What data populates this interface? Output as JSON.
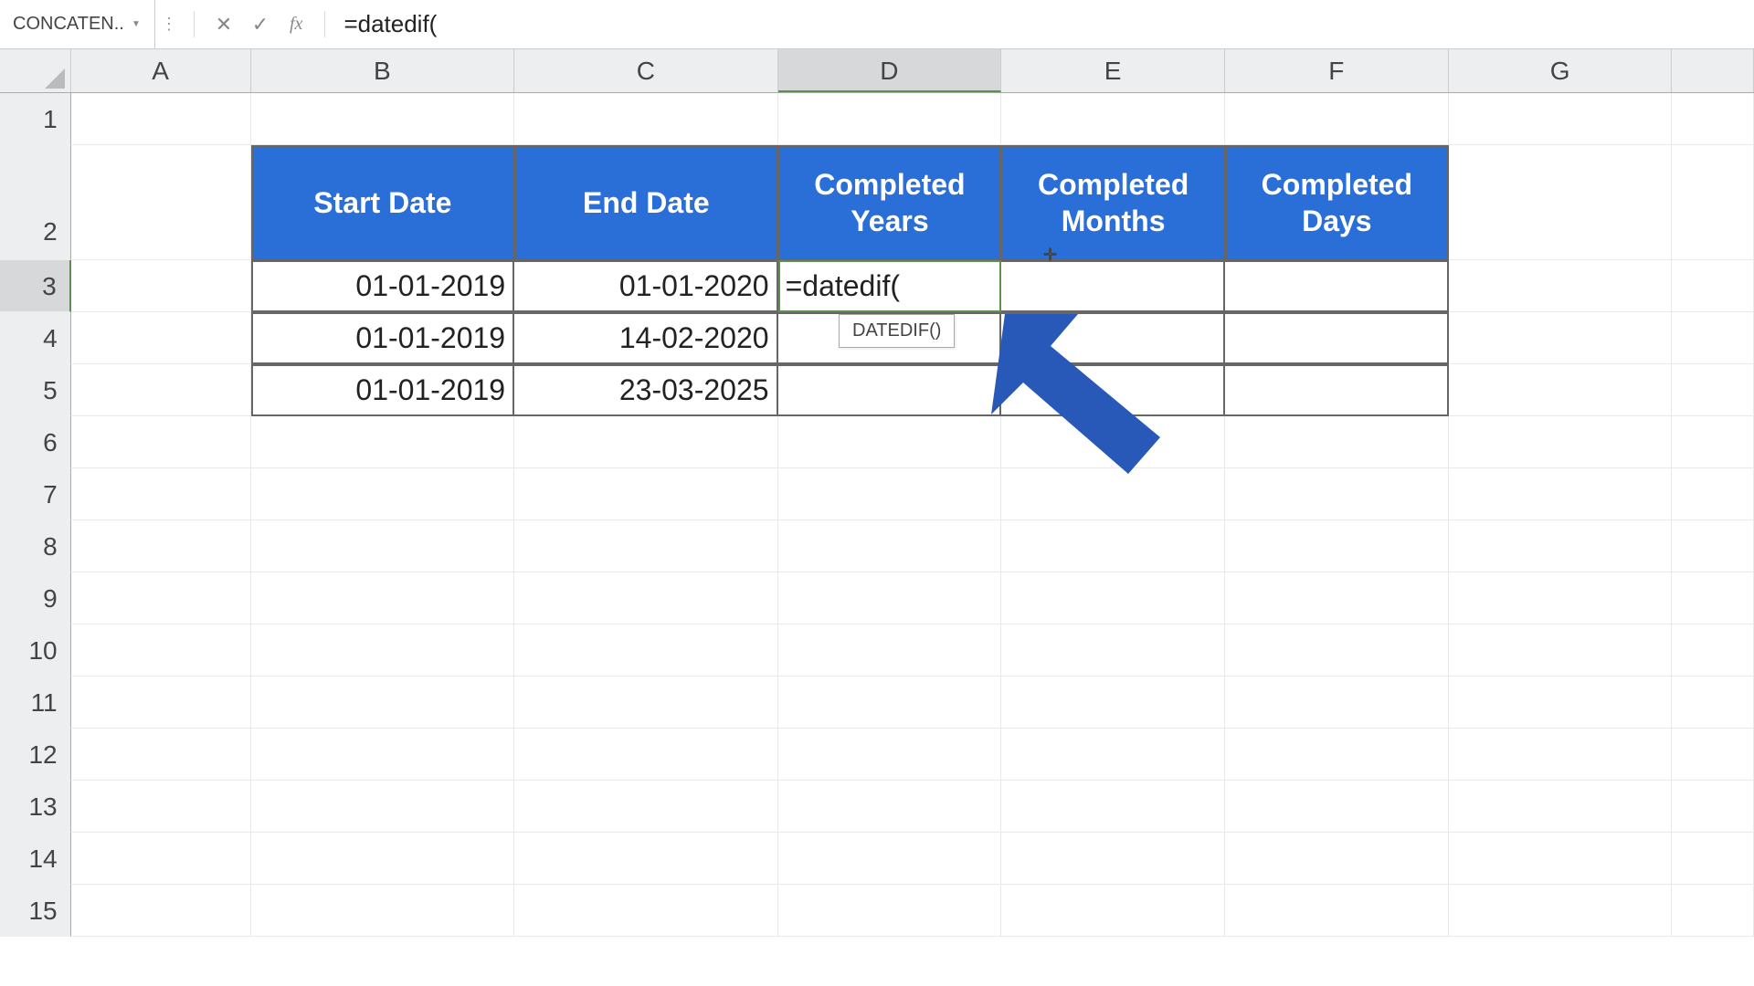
{
  "formula_bar": {
    "name_box": "CONCATEN...",
    "fx_label": "fx",
    "formula": "=datedif("
  },
  "columns": [
    "A",
    "B",
    "C",
    "D",
    "E",
    "F",
    "G"
  ],
  "active_column": "D",
  "active_row": "3",
  "row_numbers": [
    "1",
    "2",
    "3",
    "4",
    "5",
    "6",
    "7",
    "8",
    "9",
    "10",
    "11",
    "12",
    "13",
    "14",
    "15"
  ],
  "headers": {
    "B": "Start Date",
    "C": "End Date",
    "D": "Completed Years",
    "E": "Completed Months",
    "F": "Completed Days"
  },
  "data": {
    "r3": {
      "B": "01-01-2019",
      "C": "01-01-2020",
      "D": "=datedif("
    },
    "r4": {
      "B": "01-01-2019",
      "C": "14-02-2020"
    },
    "r5": {
      "B": "01-01-2019",
      "C": "23-03-2025"
    }
  },
  "tooltip": "DATEDIF()",
  "icons": {
    "cancel": "✕",
    "confirm": "✓",
    "dropdown": "▼",
    "dots": "⋮"
  }
}
